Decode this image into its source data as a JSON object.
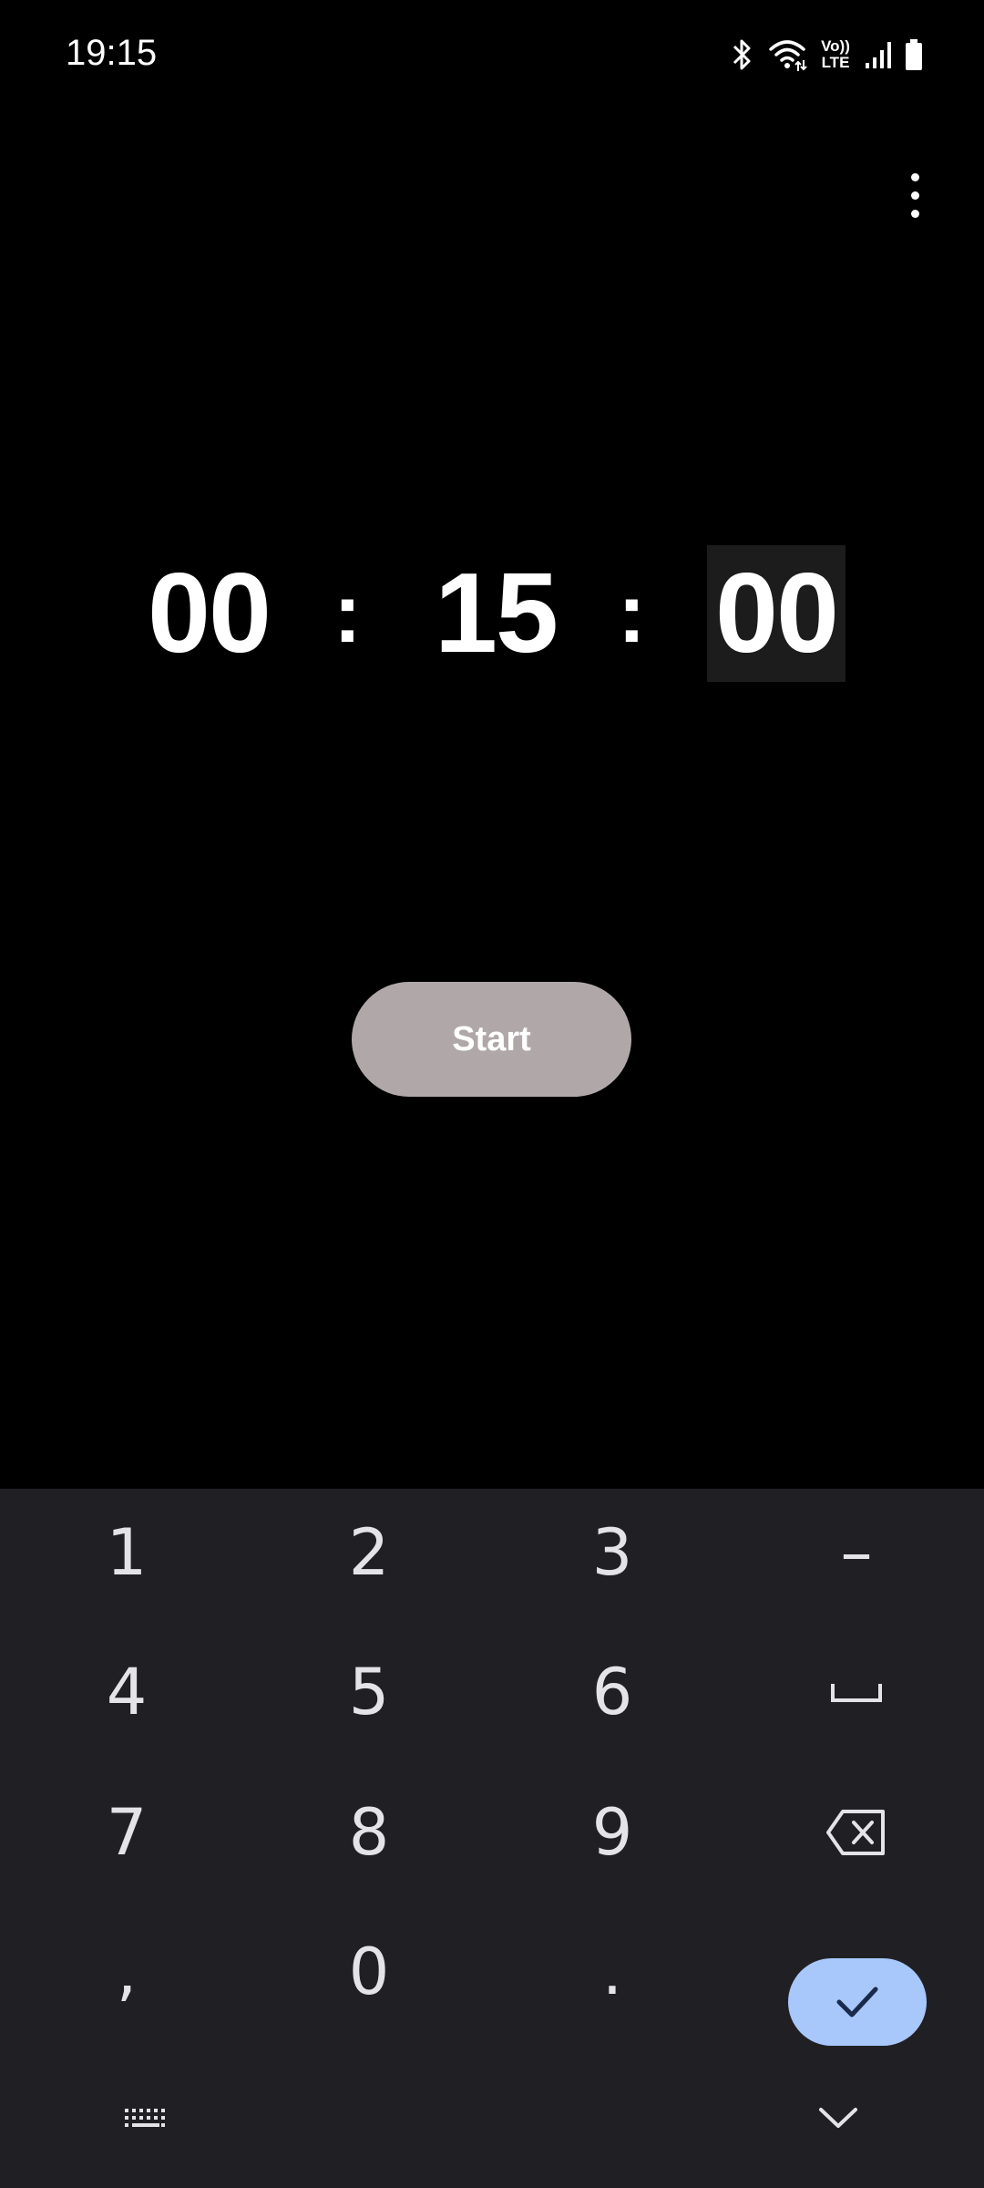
{
  "status_bar": {
    "time": "19:15",
    "volte_top": "Vo))",
    "volte_bottom": "LTE",
    "icons": [
      "bluetooth-icon",
      "wifi-icon",
      "volte-icon",
      "signal-icon",
      "battery-icon"
    ]
  },
  "toolbar": {
    "more_icon": "more-vert-icon"
  },
  "timer": {
    "hours": "00",
    "minutes": "15",
    "seconds": "00",
    "separator": ":",
    "selected_field": "seconds"
  },
  "actions": {
    "start_label": "Start"
  },
  "keypad": {
    "keys": {
      "k1": "1",
      "k2": "2",
      "k3": "3",
      "k4": "4",
      "k5": "5",
      "k6": "6",
      "k7": "7",
      "k8": "8",
      "k9": "9",
      "k0": "0",
      "comma": ",",
      "period": ".",
      "minus": "–"
    },
    "icons": {
      "space": "space-bar-icon",
      "backspace": "backspace-icon",
      "enter": "check-icon",
      "keyboard": "keyboard-icon",
      "hide": "chevron-down-icon"
    },
    "enter_color": "#a8c7fa",
    "background_color": "#202024"
  }
}
